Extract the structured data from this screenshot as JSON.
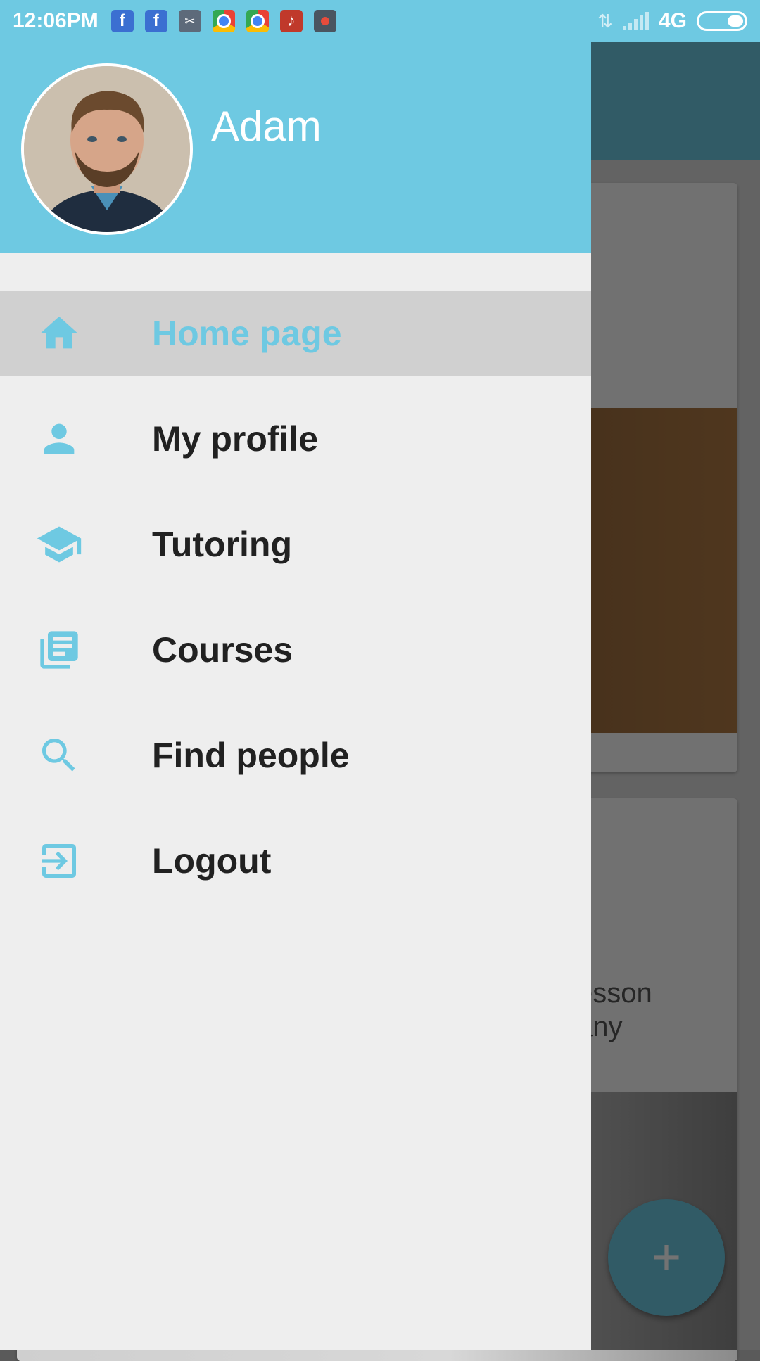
{
  "status_bar": {
    "time": "12:06PM",
    "network": "4G",
    "notification_icons": [
      "facebook-icon",
      "facebook-icon",
      "scissors-app-icon",
      "chrome-icon",
      "chrome-icon",
      "music-app-icon",
      "screen-recorder-icon"
    ]
  },
  "drawer": {
    "user_name": "Adam",
    "menu": [
      {
        "label": "Home page",
        "icon": "home-icon",
        "selected": true
      },
      {
        "label": "My profile",
        "icon": "person-icon",
        "selected": false
      },
      {
        "label": "Tutoring",
        "icon": "graduation-cap-icon",
        "selected": false
      },
      {
        "label": "Courses",
        "icon": "library-books-icon",
        "selected": false
      },
      {
        "label": "Find people",
        "icon": "search-icon",
        "selected": false
      },
      {
        "label": "Logout",
        "icon": "logout-icon",
        "selected": false
      }
    ]
  },
  "background": {
    "partial_text_line1": "esson",
    "partial_text_line2": "any",
    "fab_label": "+"
  },
  "colors": {
    "accent": "#6ec9e2",
    "drawer_bg": "#eeeeee",
    "selected_bg": "#d0d0d0",
    "text": "#212121"
  }
}
